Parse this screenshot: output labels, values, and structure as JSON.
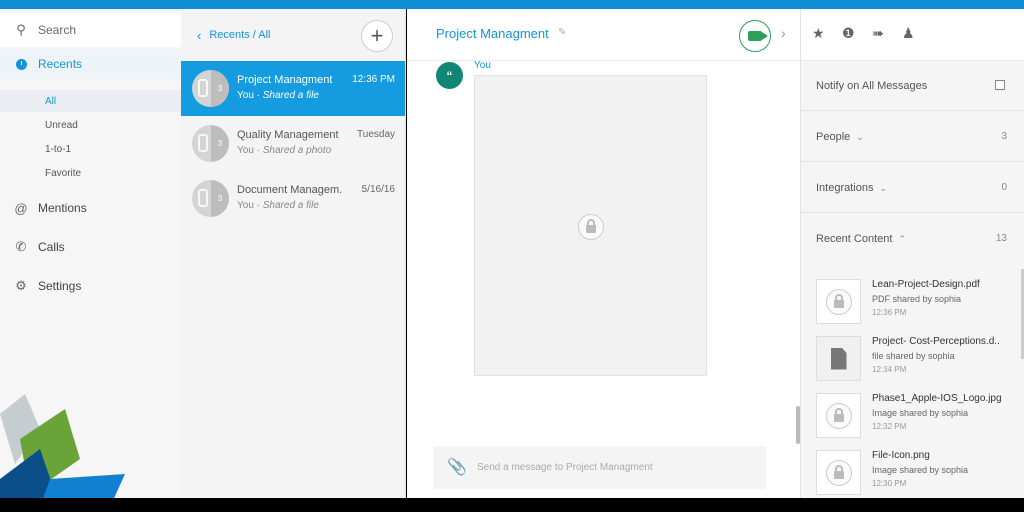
{
  "nav": {
    "search_label": "Search",
    "recents_label": "Recents",
    "sub_items": [
      {
        "label": "All",
        "active": true
      },
      {
        "label": "Unread",
        "active": false
      },
      {
        "label": "1-to-1",
        "active": false
      },
      {
        "label": "Favorite",
        "active": false
      }
    ],
    "mentions_label": "Mentions",
    "calls_label": "Calls",
    "settings_label": "Settings"
  },
  "list": {
    "breadcrumb": "Recents / All",
    "conversations": [
      {
        "title": "Project Managment",
        "time": "12:36 PM",
        "sender": "You",
        "action": "Shared a file",
        "avatar_badge": "3",
        "selected": true
      },
      {
        "title": "Quality Management",
        "time": "Tuesday",
        "sender": "You",
        "action": "Shared a photo",
        "avatar_badge": "3",
        "selected": false
      },
      {
        "title": "Document Managem.",
        "time": "5/16/16",
        "sender": "You",
        "action": "Shared a file",
        "avatar_badge": "3",
        "selected": false
      }
    ]
  },
  "chat": {
    "title": "Project Managment",
    "message_sender": "You",
    "message_avatar_glyph": "“",
    "composer_placeholder": "Send a message to Project Managment"
  },
  "details": {
    "notify_label": "Notify on All Messages",
    "people_label": "People",
    "people_count": "3",
    "integrations_label": "Integrations",
    "integrations_count": "0",
    "recent_content_label": "Recent Content",
    "recent_content_count": "13",
    "files": [
      {
        "name": "Lean-Project-Design.pdf",
        "shared_by": "PDF shared by sophia",
        "time": "12:36 PM",
        "thumb": "lock"
      },
      {
        "name": "Project- Cost-Perceptions.d..",
        "shared_by": "file shared by sophia",
        "time": "12:34 PM",
        "thumb": "doc"
      },
      {
        "name": "Phase1_Apple-IOS_Logo.jpg",
        "shared_by": "Image shared by sophia",
        "time": "12:32 PM",
        "thumb": "lock"
      },
      {
        "name": "File-Icon.png",
        "shared_by": "Image shared by sophia",
        "time": "12:30 PM",
        "thumb": "lock"
      }
    ]
  },
  "colors": {
    "accent": "#1494d9",
    "selected_row": "#149be0",
    "video_green": "#2aa05a",
    "message_avatar": "#118675"
  }
}
